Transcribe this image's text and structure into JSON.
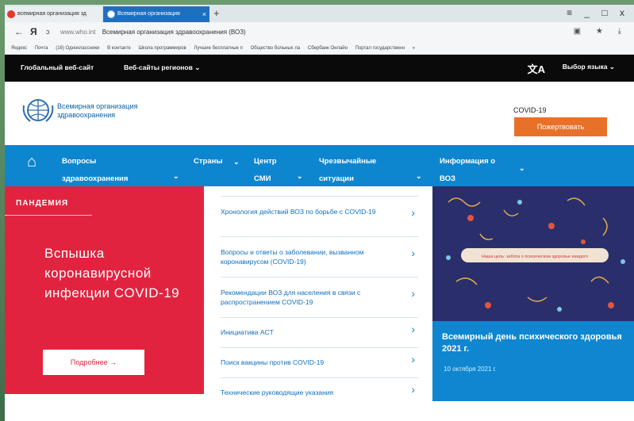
{
  "browser": {
    "tabs": [
      {
        "label": "всемирная организация зд"
      },
      {
        "label": "Всемирная организация"
      }
    ],
    "new_tab": "+",
    "window_controls": "≡ _ □ x",
    "nav": {
      "back": "←",
      "yandex": "Я",
      "reload": "ↄ"
    },
    "address": {
      "host": "www.who.int",
      "page_title": "Всемирная организация здравоохранения (ВОЗ)"
    },
    "address_right": "▣ ★ ⤓",
    "bookmarks": [
      "Яндекс",
      "Почта",
      "(16) Одноклассники",
      "В контакте",
      "Школа программиров",
      "Лучшие бесплатные п",
      "Общество больных ла",
      "Сбербанк Онлайн",
      "Портал государственн",
      "»"
    ]
  },
  "site": {
    "topnav": {
      "global": "Глобальный веб-сайт",
      "regions": "Веб-сайты регионов",
      "regions_chevron": "⌄",
      "lang_icon": "文A",
      "lang": "Выбор языка ⌄"
    },
    "logo_text": "Всемирная организация здравоохранения",
    "covid_label": "COVID-19",
    "donate": "Пожертвовать",
    "mainnav": {
      "home_icon": "⌂",
      "items": [
        {
          "label": "Вопросы здравоохранения",
          "chevron": "⌄"
        },
        {
          "label": "Страны",
          "chevron": "⌄"
        },
        {
          "label": "Центр СМИ",
          "chevron": "⌄"
        },
        {
          "label": "Чрезвычайные ситуации",
          "chevron": "⌄"
        },
        {
          "label": "Информация о ВОЗ",
          "chevron": "⌄"
        }
      ]
    },
    "pandemic": {
      "tag": "ПАНДЕМИЯ",
      "headline": "Вспышка коронавирусной инфекции COVID-19",
      "button": "Подробнее →"
    },
    "links": [
      {
        "label": "Хронология действий ВОЗ по борьбе с COVID-19",
        "arrow": "›"
      },
      {
        "label": "Вопросы и ответы о заболевании, вызванном коронавирусом (COVID-19)",
        "arrow": "›"
      },
      {
        "label": "Рекомендации ВОЗ для населения в связи с распространением COVID-19",
        "arrow": "›"
      },
      {
        "label": "Инициатива ACT",
        "arrow": "›"
      },
      {
        "label": "Поиск вакцины против COVID-19",
        "arrow": "›"
      },
      {
        "label": "Технические руководящие указания",
        "arrow": "›"
      }
    ],
    "promo": {
      "banner_text": "Наша цель: забота о психическом здоровье каждого",
      "title": "Всемирный день психического здоровья 2021 г.",
      "date": "10 октября 2021 г."
    }
  },
  "colors": {
    "who_blue": "#0e86cf",
    "pandemic_red": "#e2233f",
    "donate_orange": "#e8712a",
    "top_bar": "#0a0a0a"
  }
}
